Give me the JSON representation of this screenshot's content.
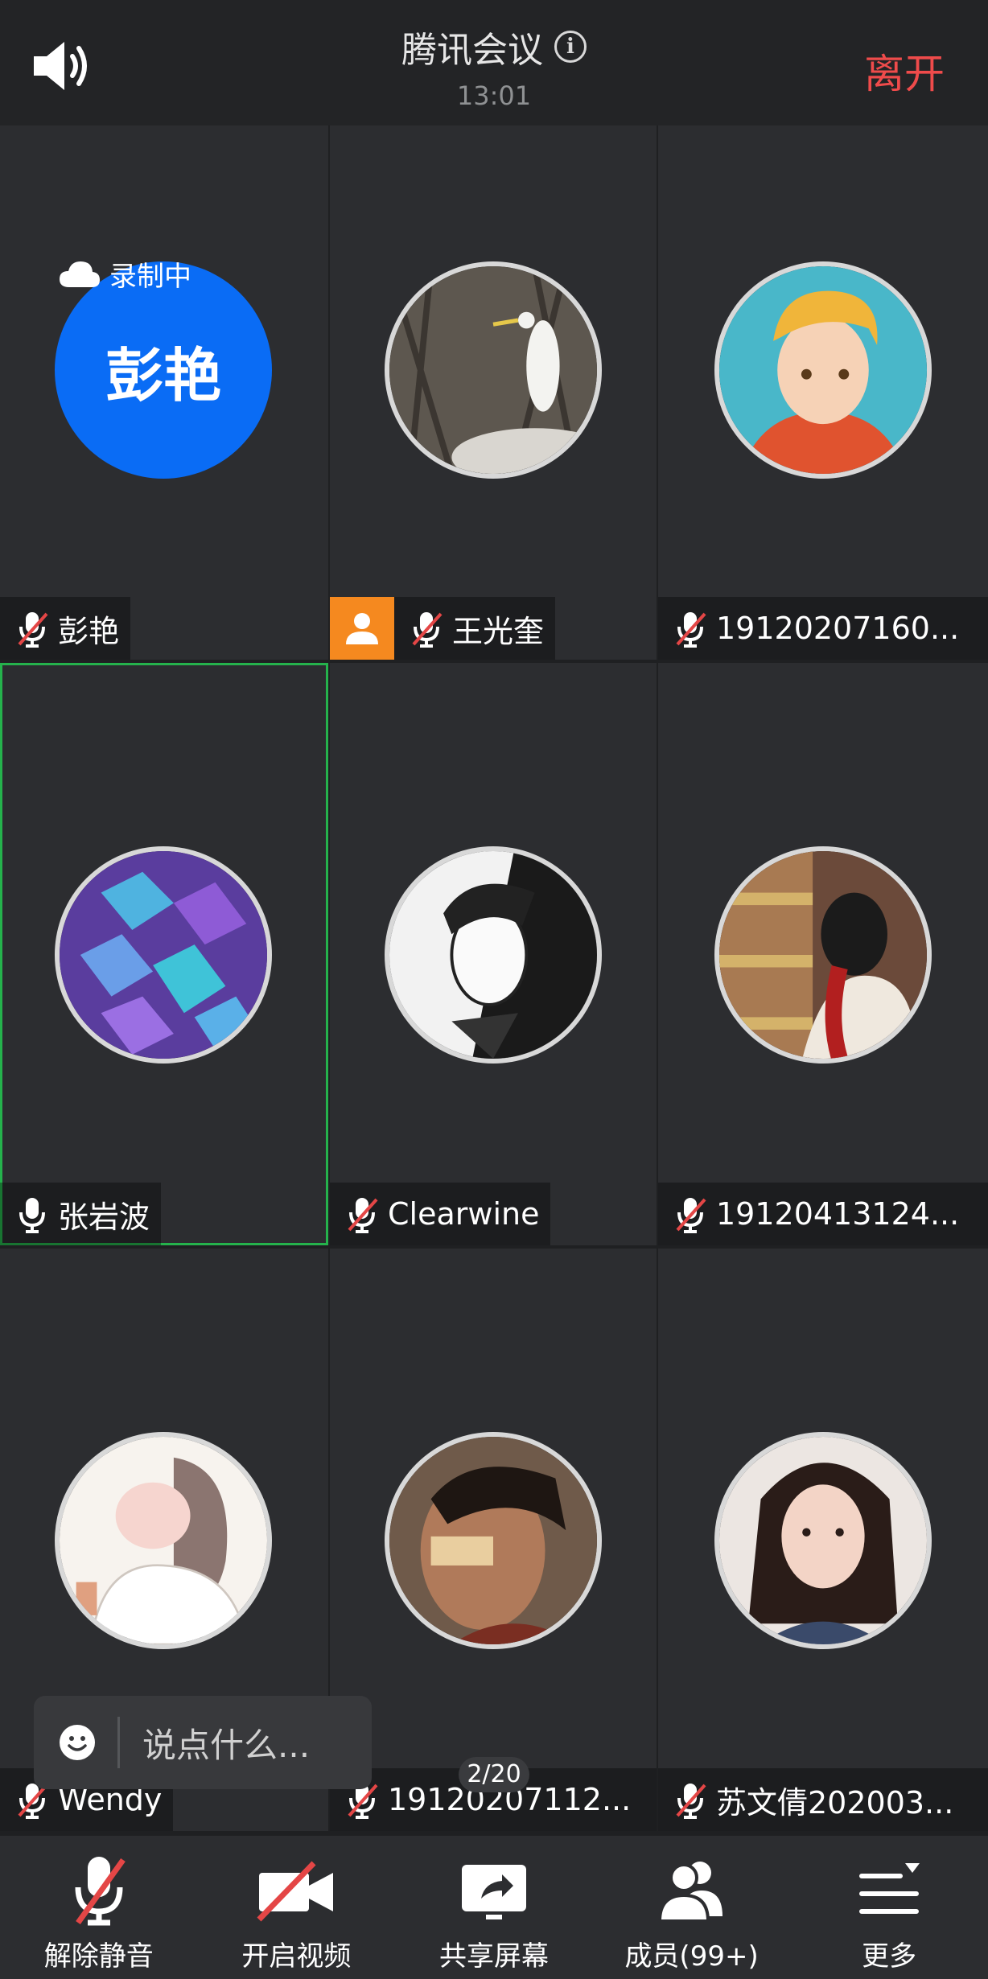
{
  "header": {
    "title": "腾讯会议",
    "time": "13:01",
    "leave_label": "离开"
  },
  "recording": {
    "label": "录制中"
  },
  "participants": [
    {
      "name": "彭艳",
      "avatar_text": "彭艳",
      "mic": "muted"
    },
    {
      "name": "王光奎",
      "mic": "muted",
      "host": true
    },
    {
      "name": "19120207160...",
      "mic": "muted"
    },
    {
      "name": "张岩波",
      "mic": "on",
      "active": true
    },
    {
      "name": "Clearwine",
      "mic": "muted"
    },
    {
      "name": "19120413124...",
      "mic": "muted"
    },
    {
      "name": "Wendy",
      "mic": "muted"
    },
    {
      "name": "19120207112...",
      "mic": "muted"
    },
    {
      "name": "苏文倩202003...",
      "mic": "muted"
    }
  ],
  "chat": {
    "placeholder": "说点什么..."
  },
  "pager": {
    "label": "2/20"
  },
  "toolbar": {
    "unmute": "解除静音",
    "video": "开启视频",
    "share": "共享屏幕",
    "members": "成员(99+)",
    "more": "更多"
  },
  "colors": {
    "accent_blue": "#0a6cf5",
    "leave_red": "#ef4b4b",
    "active_border": "#25b24c",
    "host_orange": "#f5891f"
  }
}
